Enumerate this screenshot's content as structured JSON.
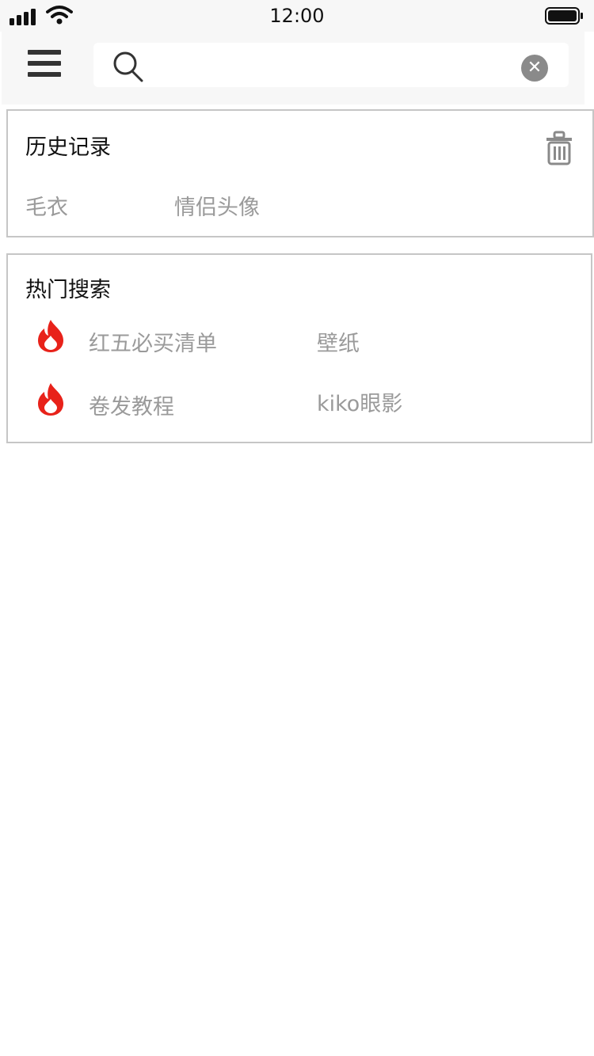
{
  "status_bar": {
    "time": "12:00",
    "icons": [
      "signal-icon",
      "wifi-icon",
      "battery-icon"
    ]
  },
  "header": {
    "menu_icon": "menu-icon",
    "search": {
      "value": "",
      "search_icon": "search-icon",
      "clear_icon": "clear-icon",
      "clear_glyph": "✕"
    }
  },
  "history": {
    "title": "历史记录",
    "delete_icon": "trash-icon",
    "items": [
      "毛衣",
      "情侣头像"
    ]
  },
  "hot": {
    "title": "热门搜索",
    "hot_icon": "fire-icon",
    "hot_color": "#e8221a",
    "items": [
      "红五必买清单",
      "壁纸",
      "卷发教程",
      "kiko眼影"
    ]
  }
}
